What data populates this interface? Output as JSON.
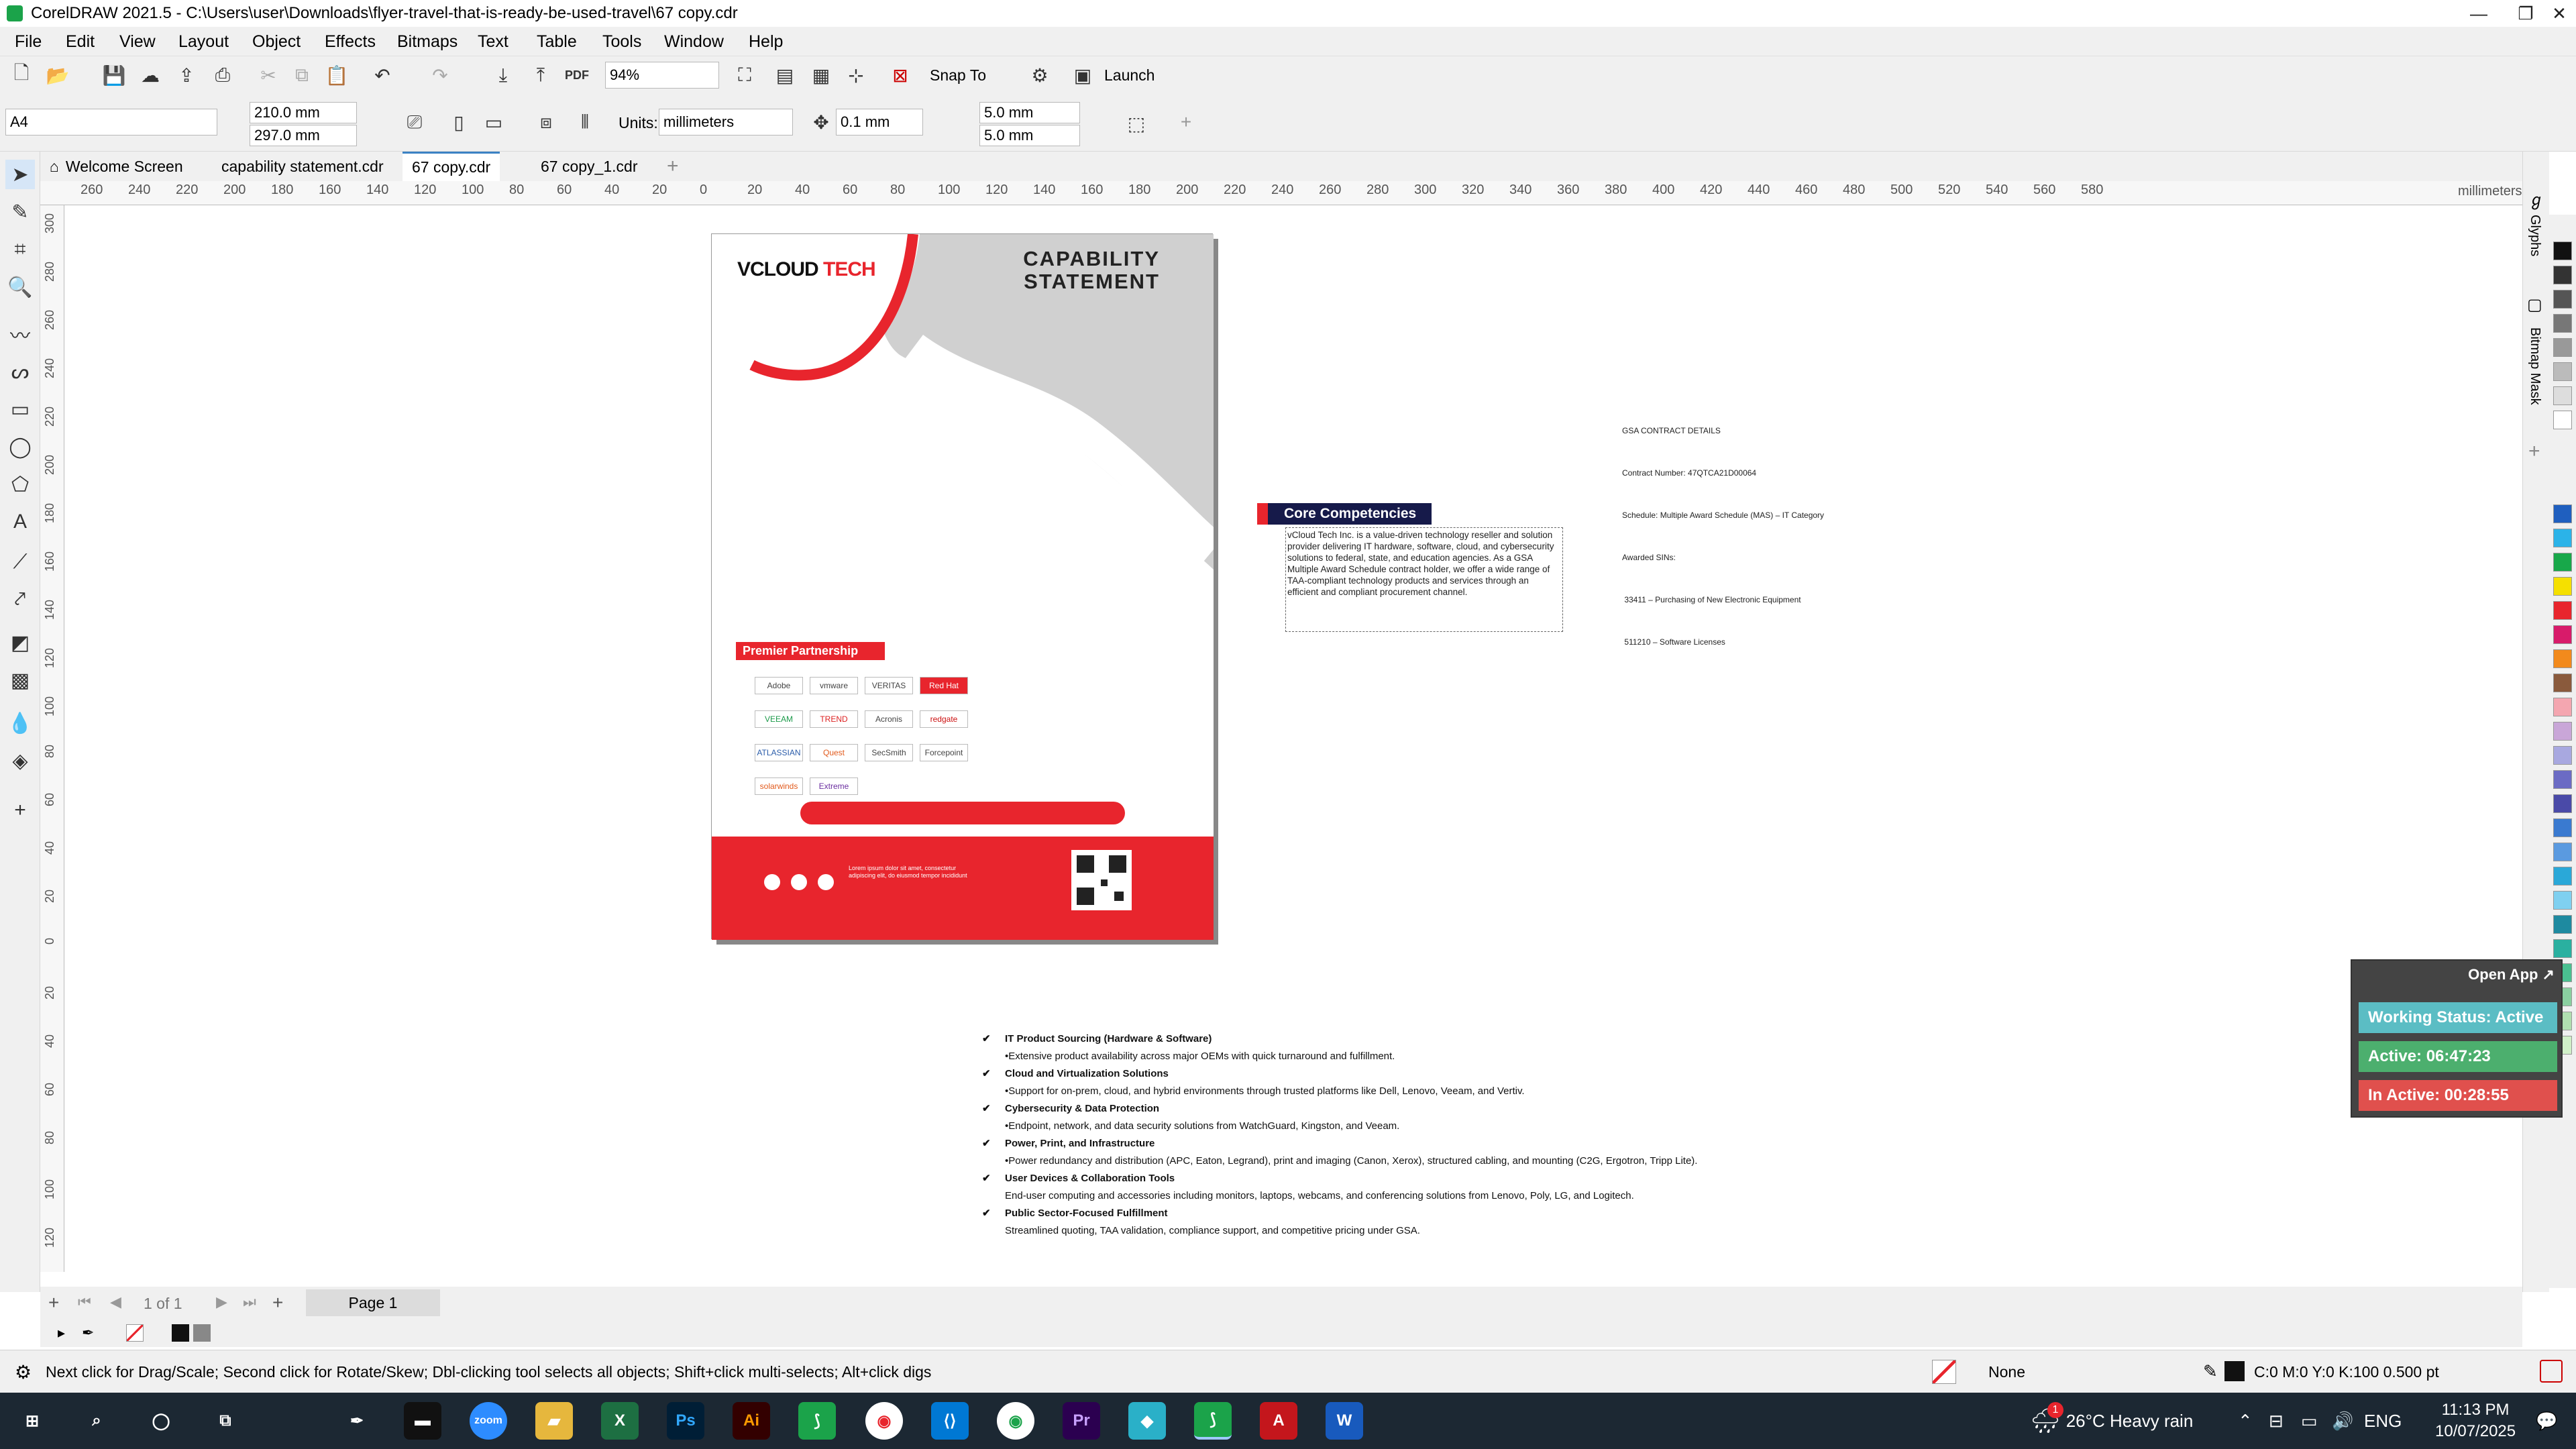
{
  "window": {
    "title": "CorelDRAW 2021.5 - C:\\Users\\user\\Downloads\\flyer-travel-that-is-ready-be-used-travel\\67 copy.cdr",
    "minimize": "—",
    "maximize": "❐",
    "close": "✕"
  },
  "menu": [
    "File",
    "Edit",
    "View",
    "Layout",
    "Object",
    "Effects",
    "Bitmaps",
    "Text",
    "Table",
    "Tools",
    "Window",
    "Help"
  ],
  "toolbar": {
    "zoom": "94%",
    "snap_to": "Snap To",
    "launch": "Launch",
    "page_size": "A4",
    "width": "210.0 mm",
    "height": "297.0 mm",
    "units_label": "Units:",
    "units": "millimeters",
    "nudge": "0.1 mm",
    "dup_x": "5.0 mm",
    "dup_y": "5.0 mm"
  },
  "tabs": [
    "Welcome Screen",
    "capability statement.cdr",
    "67 copy.cdr",
    "67 copy_1.cdr"
  ],
  "active_tab": "67 copy.cdr",
  "ruler": {
    "unit": "millimeters",
    "h_ticks": [
      "260",
      "240",
      "220",
      "200",
      "180",
      "160",
      "140",
      "120",
      "100",
      "80",
      "60",
      "40",
      "20",
      "0",
      "20",
      "40",
      "60",
      "80",
      "100",
      "120",
      "140",
      "160",
      "180",
      "200",
      "220",
      "240",
      "260",
      "280",
      "300",
      "320",
      "340",
      "360",
      "380",
      "400",
      "420",
      "440",
      "460",
      "480",
      "500",
      "520",
      "540",
      "560",
      "580"
    ],
    "v_ticks": [
      "300",
      "280",
      "260",
      "240",
      "220",
      "200",
      "180",
      "160",
      "140",
      "120",
      "100",
      "80",
      "60",
      "40",
      "20",
      "0",
      "20",
      "40",
      "60",
      "80",
      "100",
      "120"
    ]
  },
  "document": {
    "logo_main": "VCLOUD",
    "logo_accent": "TECH",
    "heading_line1": "CAPABILITY",
    "heading_line2": "STATEMENT",
    "premier_label": "Premier Partnership",
    "partners": [
      "Adobe",
      "vmware",
      "VERITAS",
      "Red Hat",
      "VEEAM",
      "TREND",
      "Acronis",
      "redgate",
      "ATLASSIAN",
      "Quest",
      "SecSmith",
      "Forcepoint",
      "solarwinds",
      "Extreme"
    ],
    "footer_text": "Lorem ipsum dolor sit amet, consectetur adipiscing elit, do eiusmod tempor incididunt"
  },
  "gsa": {
    "title": "GSA CONTRACT DETAILS",
    "lines": [
      "Contract Number: 47QTCA21D00064",
      "Schedule: Multiple Award Schedule (MAS) – IT Category",
      "Awarded SINs:",
      " 33411 – Purchasing of New Electronic Equipment",
      " 511210 – Software Licenses"
    ]
  },
  "core": {
    "label": "Core Competencies",
    "body": "vCloud Tech Inc. is a value-driven technology reseller and solution provider delivering IT hardware, software, cloud, and cybersecurity solutions to federal, state, and education agencies. As a GSA Multiple Award Schedule contract holder, we offer a wide range of TAA-compliant technology products and services through an efficient and compliant procurement channel."
  },
  "services": [
    {
      "title": "IT Product Sourcing (Hardware & Software)",
      "desc": "•Extensive product availability across major OEMs with quick turnaround and fulfillment."
    },
    {
      "title": "Cloud and Virtualization Solutions",
      "desc": "•Support for on-prem, cloud, and hybrid environments through trusted platforms like Dell, Lenovo, Veeam, and Vertiv."
    },
    {
      "title": "Cybersecurity & Data Protection",
      "desc": "•Endpoint, network, and data security solutions from WatchGuard, Kingston, and Veeam."
    },
    {
      "title": "Power, Print, and Infrastructure",
      "desc": "•Power redundancy and distribution (APC, Eaton, Legrand), print and imaging (Canon, Xerox), structured cabling, and mounting (C2G, Ergotron, Tripp Lite)."
    },
    {
      "title": "User Devices & Collaboration Tools",
      "desc": "End-user computing and accessories including monitors, laptops, webcams, and conferencing solutions from Lenovo, Poly, LG, and Logitech."
    },
    {
      "title": "Public Sector-Focused Fulfillment",
      "desc": "Streamlined quoting, TAA validation, compliance support, and competitive pricing under GSA."
    }
  ],
  "side_panels": [
    "Glyphs",
    "Bitmap Mask"
  ],
  "status_widget": {
    "open_app": "Open App ↗",
    "working": "Working Status: Active",
    "active": "Active: 06:47:23",
    "inactive": "In Active: 00:28:55",
    "colors": {
      "working": "#5bbdc4",
      "active": "#4caf6e",
      "inactive": "#e0504d"
    }
  },
  "page_nav": {
    "counter": "1 of 1",
    "page_tab": "Page 1"
  },
  "statusbar": {
    "hint": "Next click for Drag/Scale; Second click for Rotate/Skew; Dbl-clicking tool selects all objects; Shift+click multi-selects; Alt+click digs",
    "fill": "None",
    "outline": "C:0 M:0 Y:0 K:100  0.500 pt"
  },
  "taskbar": {
    "apps": [
      "Start",
      "Search",
      "Cortana",
      "Task View",
      "Pen",
      "Terminal",
      "Zoom",
      "Explorer",
      "Excel",
      "Ps",
      "Ai",
      "CorelDRAW",
      "Chrome",
      "VS Code",
      "Chrome 2",
      "Pr",
      "App",
      "CorelDRAW 2",
      "Acrobat",
      "Word"
    ],
    "weather": "26°C  Heavy rain",
    "notif_badge": "1",
    "lang": "ENG",
    "time": "11:13 PM",
    "date": "10/07/2025"
  },
  "colors": {
    "accent_red": "#e8252d",
    "navy": "#161a4a",
    "corel_green": "#1ba34a"
  }
}
